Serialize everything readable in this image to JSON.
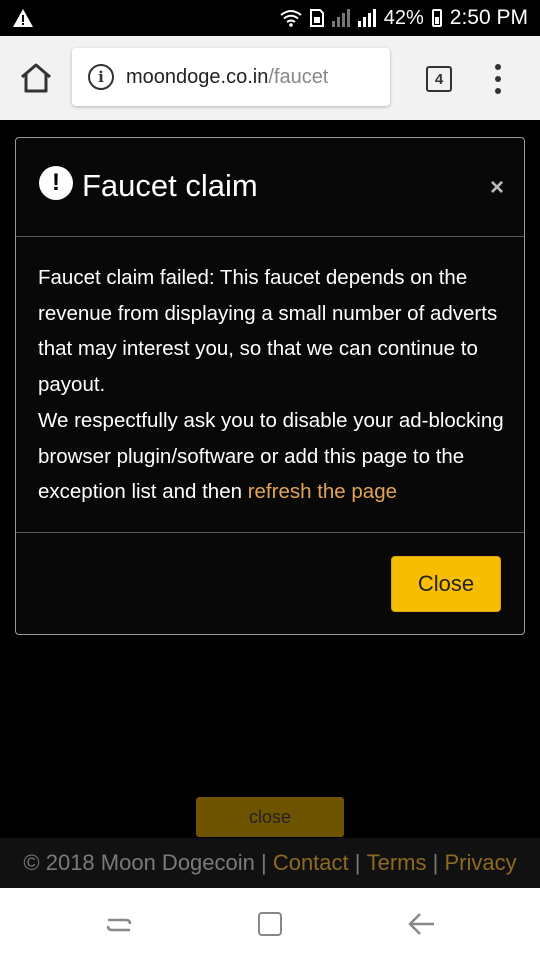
{
  "status_bar": {
    "battery": "42%",
    "time": "2:50 PM"
  },
  "browser": {
    "url_domain": "moondoge.co.in",
    "url_path": "/faucet",
    "tab_count": "4"
  },
  "modal": {
    "title": "Faucet claim",
    "close_glyph": "×",
    "body_text": "Faucet claim failed: This faucet depends on the revenue from displaying a small number of adverts that may interest you, so that we can continue to payout.",
    "body_text_2": "We respectfully ask you to disable your ad-blocking browser plugin/software or add this page to the exception list and then ",
    "body_link": "refresh the page",
    "close_button": "Close"
  },
  "page": {
    "close_button": "close",
    "footer_copyright": "© 2018 Moon Dogecoin | ",
    "footer_links": [
      "Contact",
      "Terms",
      "Privacy"
    ],
    "footer_separator": " | "
  },
  "colors": {
    "accent": "#f7bd00",
    "link": "#e2a557"
  }
}
